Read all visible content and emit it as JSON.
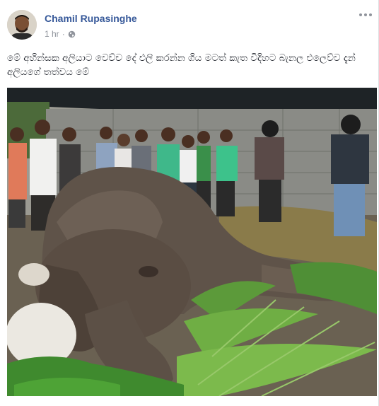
{
  "post": {
    "author": "Chamil Rupasinghe",
    "time": "1 hr",
    "separator": "·",
    "privacy_icon": "globe-icon",
    "more_icon": "more-options-icon",
    "text": "මේ අහින්සක අලියාට වෙච්ච දේ එලි කරන්න ගිය මටත් කැත විදිහට බැනල එලෙව්ව දැන් අලියගේ තත්වය මේ",
    "photo_subject": "injured-elephant-lying-on-ground"
  },
  "colors": {
    "author_link": "#365899",
    "meta_text": "#90949c",
    "body_text": "#1d2129",
    "background": "#e9ebee"
  }
}
